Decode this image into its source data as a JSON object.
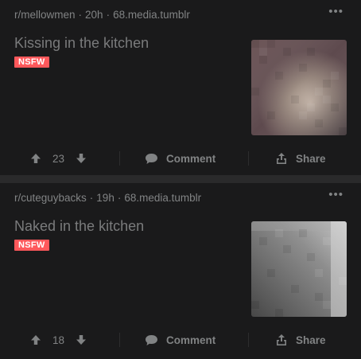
{
  "posts": [
    {
      "subreddit": "r/mellowmen",
      "age": "20h",
      "domain": "68.media.tumblr",
      "title": "Kissing in the kitchen",
      "badge": "NSFW",
      "votes": "23",
      "comment_label": "Comment",
      "share_label": "Share",
      "more_label": "•••"
    },
    {
      "subreddit": "r/cuteguybacks",
      "age": "19h",
      "domain": "68.media.tumblr",
      "title": "Naked in the kitchen",
      "badge": "NSFW",
      "votes": "18",
      "comment_label": "Comment",
      "share_label": "Share",
      "more_label": "•••"
    }
  ],
  "colors": {
    "nsfw_badge": "#ff585b",
    "card_bg": "#1a1a1b",
    "feed_bg": "#2a2a2b",
    "muted_text": "#818384"
  },
  "icons": [
    "upvote-icon",
    "downvote-icon",
    "comment-icon",
    "share-icon",
    "more-icon"
  ]
}
